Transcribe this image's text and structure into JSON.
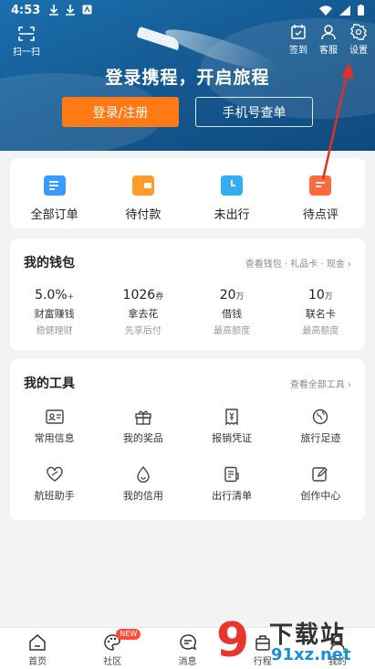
{
  "status_bar": {
    "time": "4:53"
  },
  "header": {
    "scan_label": "扫一扫",
    "signin_label": "签到",
    "service_label": "客服",
    "settings_label": "设置",
    "title": "登录携程，开启旅程",
    "login_button": "登录/注册",
    "phone_button": "手机号查单"
  },
  "orders": [
    {
      "label": "全部订单",
      "icon": "order-list-icon",
      "color": "#3a9bff"
    },
    {
      "label": "待付款",
      "icon": "wallet-icon",
      "color": "#ff9c2b"
    },
    {
      "label": "未出行",
      "icon": "clock-ticket-icon",
      "color": "#33aef3"
    },
    {
      "label": "待点评",
      "icon": "comment-icon",
      "color": "#ff6b3d"
    }
  ],
  "wallet": {
    "title": "我的钱包",
    "more": "查看钱包 · 礼品卡 · 现金 ›",
    "items": [
      {
        "value": "5.0%",
        "unit": "+",
        "label": "财富赚钱",
        "sub": "稳健理财"
      },
      {
        "value": "1026",
        "unit": "券",
        "label": "拿去花",
        "sub": "先享后付"
      },
      {
        "value": "20",
        "unit": "万",
        "label": "借钱",
        "sub": "最高额度"
      },
      {
        "value": "10",
        "unit": "万",
        "label": "联名卡",
        "sub": "最高额度"
      }
    ]
  },
  "tools": {
    "title": "我的工具",
    "more": "查看全部工具 ›",
    "items": [
      {
        "label": "常用信息",
        "icon": "id-card-icon"
      },
      {
        "label": "我的奖品",
        "icon": "gift-icon"
      },
      {
        "label": "报销凭证",
        "icon": "receipt-icon"
      },
      {
        "label": "旅行足迹",
        "icon": "globe-icon"
      },
      {
        "label": "航班助手",
        "icon": "heart-plane-icon"
      },
      {
        "label": "我的信用",
        "icon": "credit-drop-icon"
      },
      {
        "label": "出行清单",
        "icon": "checklist-icon"
      },
      {
        "label": "创作中心",
        "icon": "edit-icon"
      }
    ]
  },
  "tabbar": {
    "items": [
      {
        "label": "首页",
        "icon": "home-icon"
      },
      {
        "label": "社区",
        "icon": "palette-icon",
        "badge": "NEW"
      },
      {
        "label": "消息",
        "icon": "message-icon"
      },
      {
        "label": "行程",
        "icon": "suitcase-icon"
      },
      {
        "label": "我的",
        "icon": "user-icon"
      }
    ]
  },
  "watermark": {
    "logo": "9",
    "text": "下载站",
    "url": "91xz.net"
  },
  "colors": {
    "accent": "#ff7a14",
    "header_blue": "#155a93",
    "annotation_red": "#e0302a"
  }
}
